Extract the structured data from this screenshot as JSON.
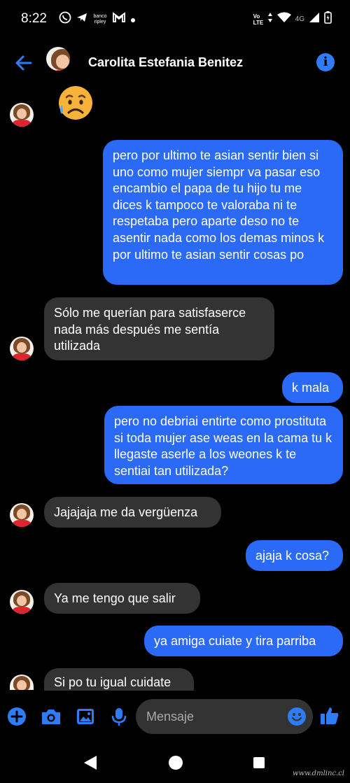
{
  "status_bar": {
    "time": "8:22",
    "bank_label": "banco ripley",
    "volte": "Vo LTE",
    "network": "4G"
  },
  "header": {
    "contact_name": "Carolita Estefania Benitez"
  },
  "messages": [
    {
      "direction": "incoming",
      "type": "sticker",
      "icon": "crying-face-emoji"
    },
    {
      "direction": "outgoing",
      "text": "pero por ultimo te asian sentir bien si uno como mujer siempr va pasar eso encambio el papa de tu hijo tu me dices k tampoco te valoraba ni te respetaba pero aparte deso no te asentir nada como los demas minos k por ultimo te asian sentir cosas po"
    },
    {
      "direction": "incoming",
      "text": "Sólo me querían para satisfaserce nada más después me sentía utilizada"
    },
    {
      "direction": "outgoing",
      "text": "k mala"
    },
    {
      "direction": "outgoing",
      "text": "pero no debriai entirte como prostituta si toda mujer ase weas en la cama tu k llegaste aserle a los weones k te sentiai tan utilizada?"
    },
    {
      "direction": "incoming",
      "text": "Jajajaja me da vergüenza"
    },
    {
      "direction": "outgoing",
      "text": "ajaja k cosa?"
    },
    {
      "direction": "incoming",
      "text": "Ya me tengo que salir"
    },
    {
      "direction": "outgoing",
      "text": "ya amiga cuiate y tira parriba"
    },
    {
      "direction": "incoming",
      "text": "Si po tu igual cuidate"
    }
  ],
  "composer": {
    "placeholder": "Mensaje"
  },
  "watermark": "www.dmlinc.cl",
  "colors": {
    "outgoing_bubble": "#2a6af6",
    "incoming_bubble": "#333333",
    "accent": "#2f7df6",
    "background": "#000000"
  }
}
